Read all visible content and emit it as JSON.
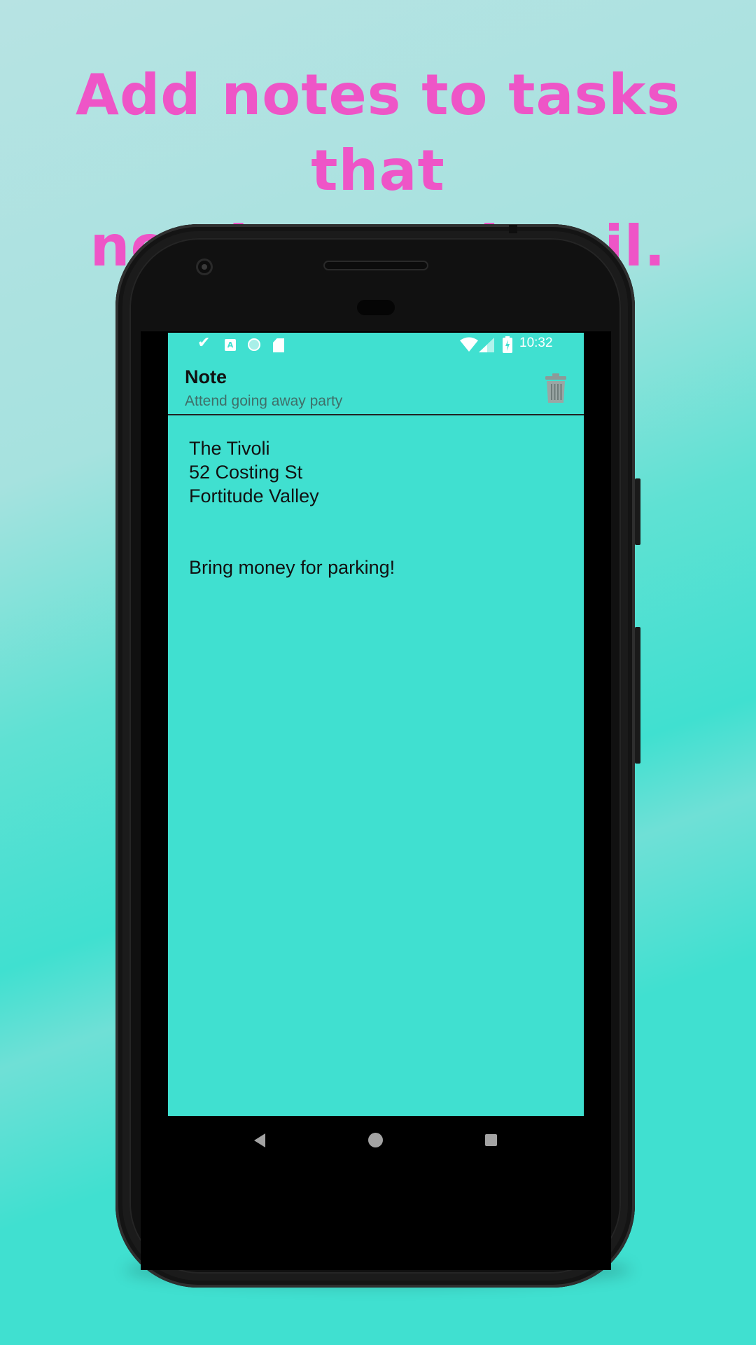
{
  "promo": {
    "headline_line1": "Add notes to tasks that",
    "headline_line2": "need extra detail."
  },
  "status_bar": {
    "time": "10:32",
    "left_icons": [
      "check-icon",
      "a-icon",
      "circle-icon",
      "sd-card-icon"
    ],
    "right_icons": [
      "wifi-icon",
      "signal-icon",
      "battery-charging-icon"
    ],
    "a_icon_text": "A"
  },
  "toolbar": {
    "title": "Note",
    "subtitle": "Attend going away party",
    "delete_icon": "trash-icon"
  },
  "note": {
    "lines": [
      "The Tivoli",
      "52 Costing St",
      "Fortitude Valley",
      "",
      "",
      "Bring money for parking!"
    ]
  },
  "nav_bar": {
    "icons": [
      "back-icon",
      "home-icon",
      "recents-icon"
    ]
  },
  "colors": {
    "headline": "#ee55c7",
    "app_background": "#40e0d0",
    "page_background": "#40e0d0"
  }
}
